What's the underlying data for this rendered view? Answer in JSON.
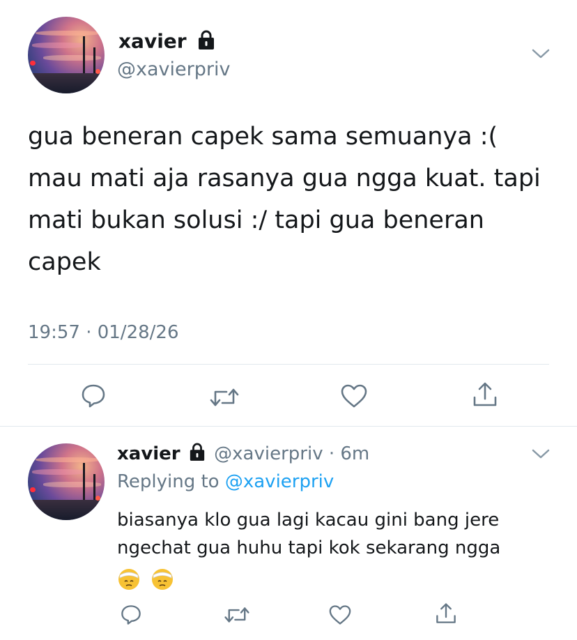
{
  "main_tweet": {
    "display_name": "xavier",
    "handle": "@xavierpriv",
    "text": "gua beneran capek sama semuanya :( mau mati aja rasanya gua ngga kuat. tapi mati bukan solusi :/ tapi gua beneran capek",
    "timestamp": "19:57 · 01/28/26"
  },
  "reply_tweet": {
    "display_name": "xavier",
    "handle": "@xavierpriv",
    "separator": "·",
    "age": "6m",
    "replying_to_prefix": "Replying to",
    "replying_to_handle": "@xavierpriv",
    "text": "biasanya klo gua lagi kacau gini bang jere ngechat gua huhu tapi kok sekarang ngga"
  },
  "icons": {
    "lock": "lock-icon",
    "menu": "chevron-down-icon",
    "reply": "comment-icon",
    "retweet": "retweet-icon",
    "like": "heart-icon",
    "share": "share-icon",
    "emoji": "face-with-head-bandage-emoji"
  },
  "colors": {
    "text": "#14171a",
    "muted": "#657786",
    "link": "#1da1f2",
    "divider": "#e1e8ed"
  }
}
